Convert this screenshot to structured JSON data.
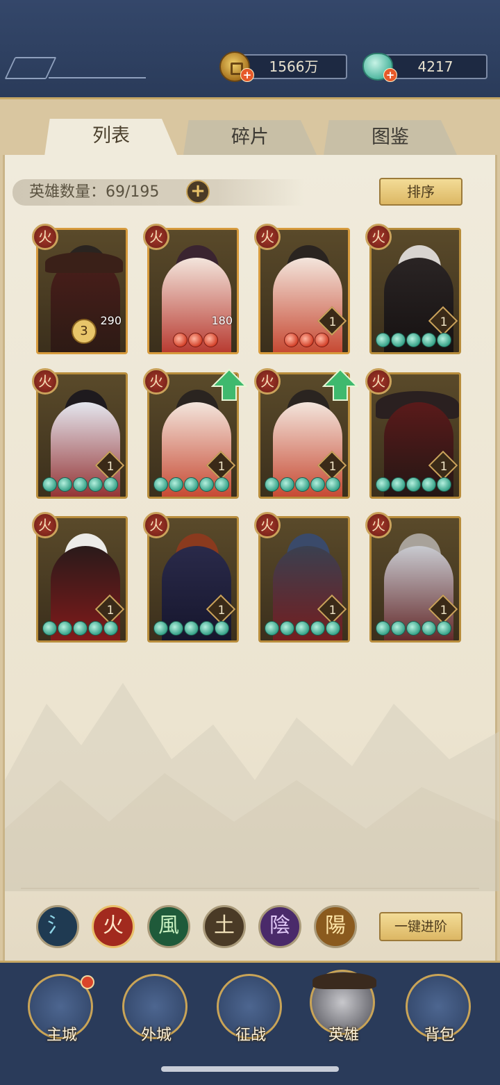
{
  "resources": {
    "coins": "1566万",
    "jade": "4217"
  },
  "tabs": [
    {
      "label": "列表",
      "active": true
    },
    {
      "label": "碎片",
      "active": false
    },
    {
      "label": "图鉴",
      "active": false
    }
  ],
  "hero_count": "英雄数量：69/195",
  "sort_label": "排序",
  "advance_all_label": "一键进阶",
  "element_filters": [
    "氵",
    "火",
    "風",
    "土",
    "陰",
    "陽"
  ],
  "heroes": [
    {
      "row": 1,
      "level": "290",
      "stars": "3",
      "jades": 0
    },
    {
      "row": 1,
      "level": "180",
      "jades": 3,
      "red": true
    },
    {
      "row": 1,
      "level": "1",
      "jades": 3,
      "red": true
    },
    {
      "row": 1,
      "level": "1",
      "jades": 5
    },
    {
      "row": 2,
      "level": "1",
      "jades": 5
    },
    {
      "row": 2,
      "level": "1",
      "jades": 5,
      "upgrade": true
    },
    {
      "row": 2,
      "level": "1",
      "jades": 5,
      "upgrade": true
    },
    {
      "row": 2,
      "level": "1",
      "jades": 5
    },
    {
      "row": 3,
      "level": "1",
      "jades": 5
    },
    {
      "row": 3,
      "level": "1",
      "jades": 5
    },
    {
      "row": 3,
      "level": "1",
      "jades": 5
    },
    {
      "row": 3,
      "level": "1",
      "jades": 5
    }
  ],
  "hero_badge": "火",
  "nav": [
    {
      "label": "主城"
    },
    {
      "label": "外城"
    },
    {
      "label": "征战"
    },
    {
      "label": "英雄"
    },
    {
      "label": "背包"
    }
  ]
}
